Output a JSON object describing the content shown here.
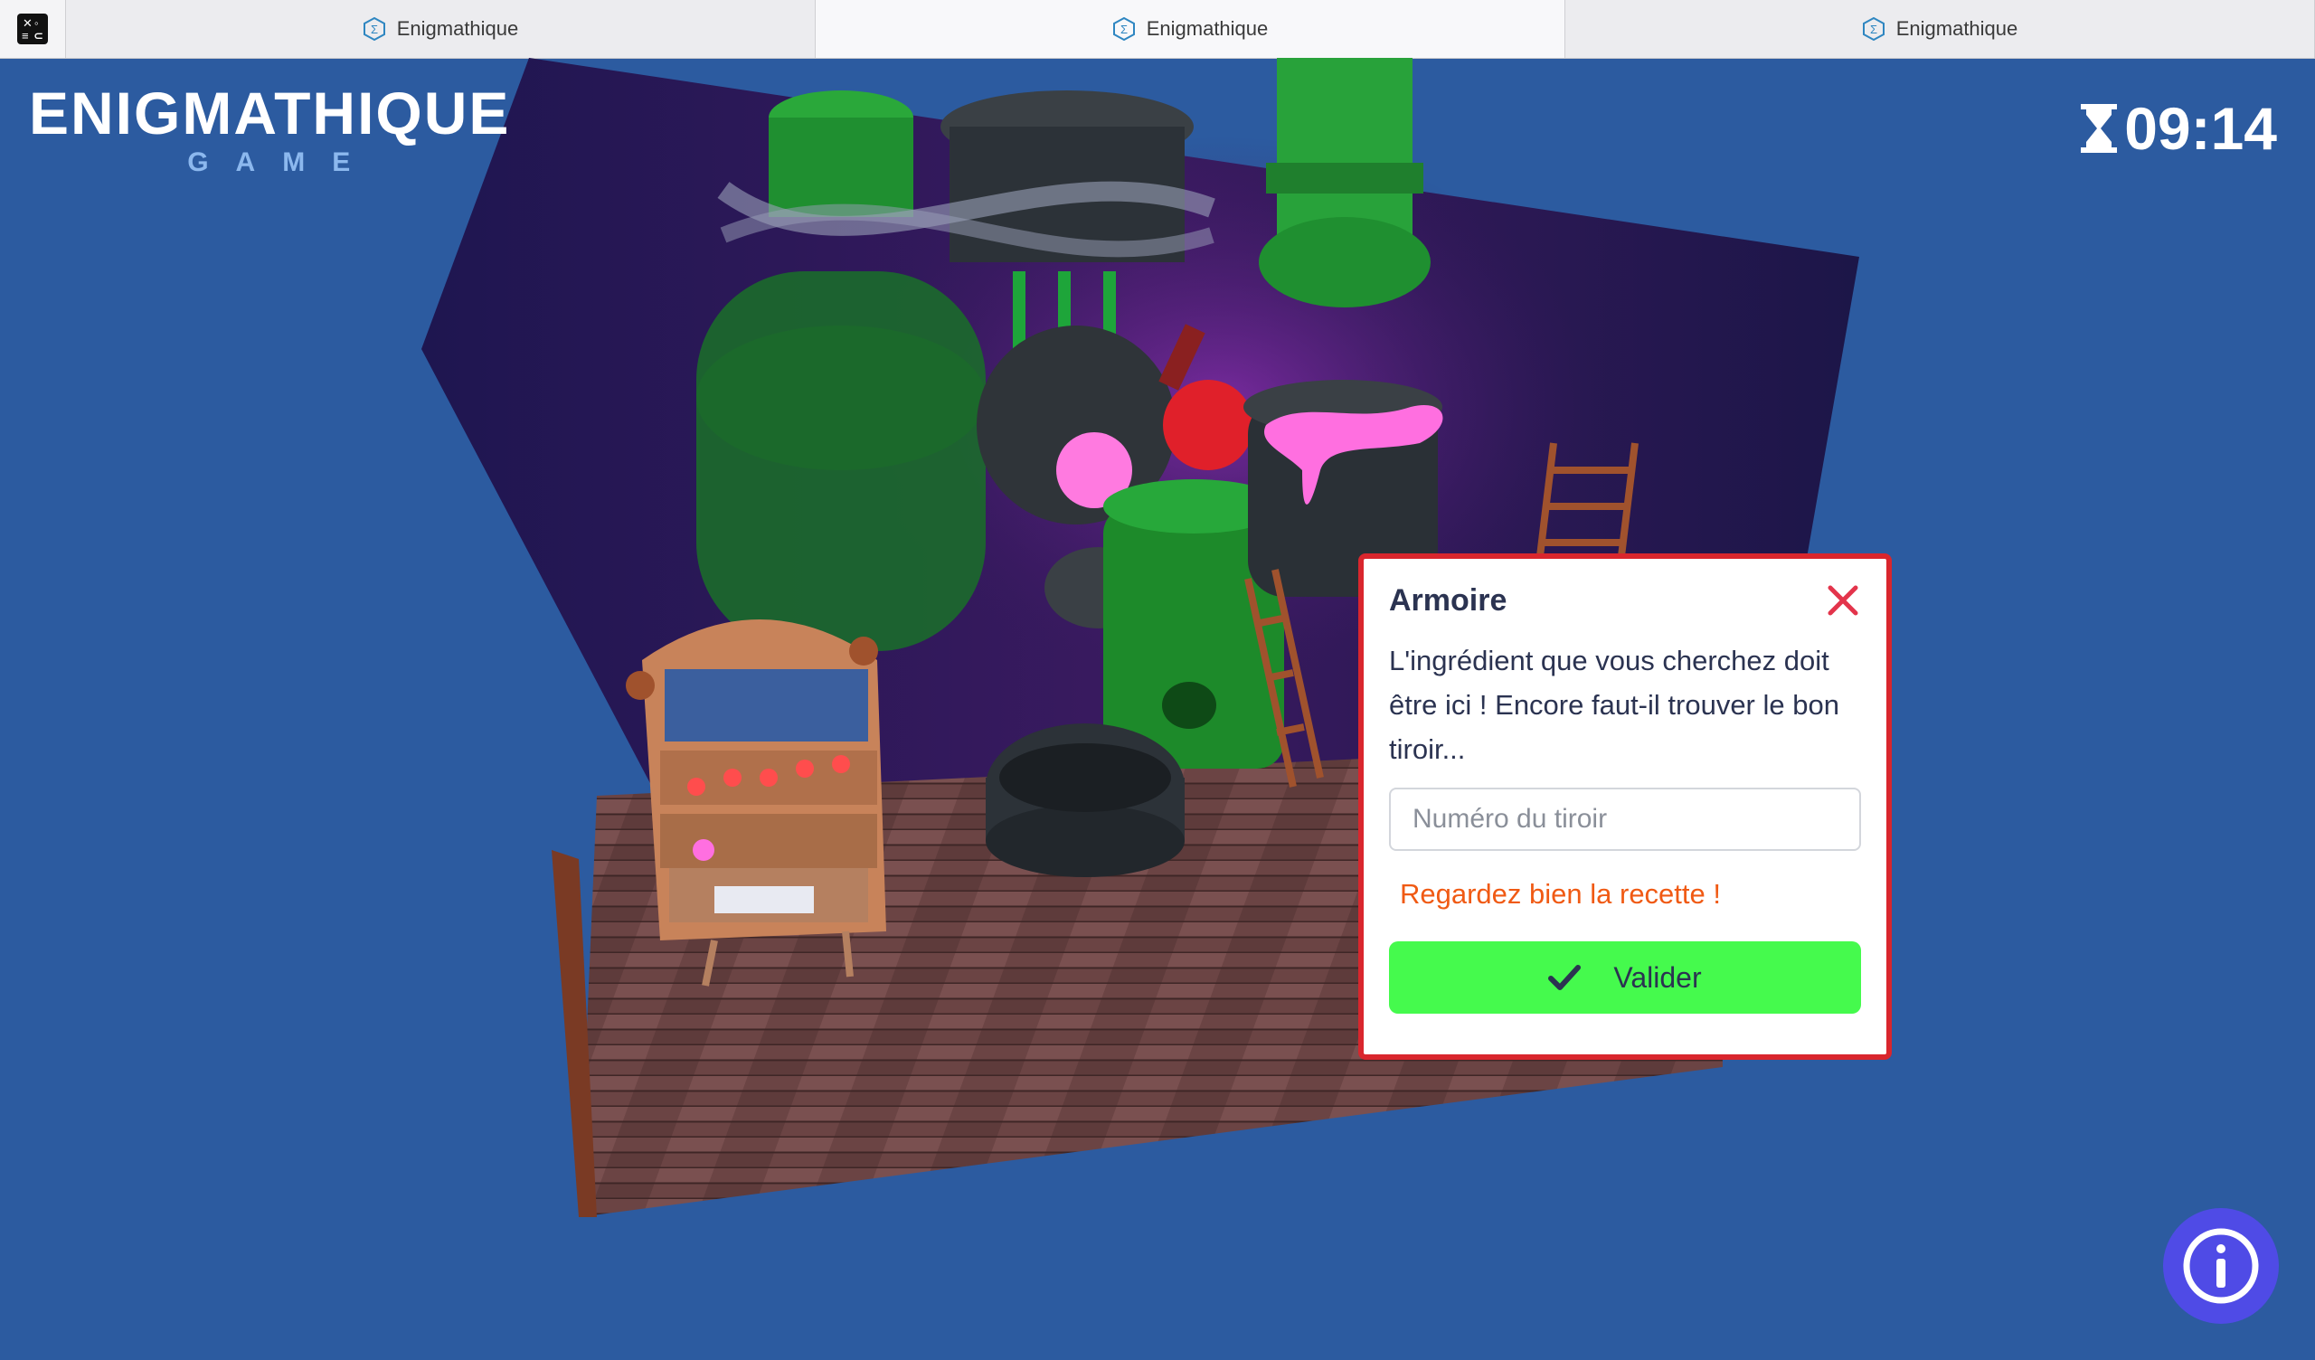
{
  "tabs": [
    {
      "label": "Enigmathique",
      "active": false
    },
    {
      "label": "Enigmathique",
      "active": true
    },
    {
      "label": "Enigmathique",
      "active": false
    }
  ],
  "logo": {
    "line1": "ENIGMATHIQUE",
    "line2": "GAME"
  },
  "timer": {
    "value": "09:14",
    "icon": "hourglass-icon"
  },
  "dialog": {
    "title": "Armoire",
    "message": "L'ingrédient que vous cherchez doit être ici ! Encore faut-il trouver le bon tiroir...",
    "input_placeholder": "Numéro du tiroir",
    "input_value": "",
    "hint": "Regardez bien la recette !",
    "validate_label": "Valider"
  },
  "colors": {
    "background": "#2c5ba0",
    "dialog_border": "#d9262d",
    "hint": "#f05a14",
    "validate": "#45fa4d",
    "info_button": "#4f4be6"
  }
}
